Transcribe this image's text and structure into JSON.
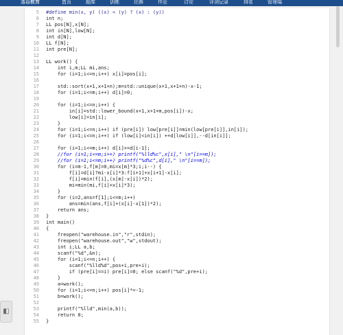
{
  "header": {
    "logo": "洛谷教育",
    "nav": [
      "首页",
      "题库",
      "训练",
      "比赛",
      "作业",
      "讨论",
      "评测记录",
      "排名",
      "管理端"
    ]
  },
  "side_button": "◧",
  "code_lines": [
    {
      "n": "5",
      "t": "#define min(x, y) ((x) < (y) ? (x) : (y))",
      "k": "pre"
    },
    {
      "n": "6",
      "t": "int n;"
    },
    {
      "n": "7",
      "t": "LL pos[N],x[N];"
    },
    {
      "n": "8",
      "t": "int in[N],low[N];"
    },
    {
      "n": "9",
      "t": "int d[N];"
    },
    {
      "n": "10",
      "t": "LL f[N];"
    },
    {
      "n": "11",
      "t": "int pre[N];"
    },
    {
      "n": "12",
      "t": ""
    },
    {
      "n": "13",
      "t": "LL work() {"
    },
    {
      "n": "14",
      "t": "    int i,m;LL mi,ans;"
    },
    {
      "n": "15",
      "t": "    for (i=1;i<=n;i++) x[i]=pos[i];"
    },
    {
      "n": "16",
      "t": ""
    },
    {
      "n": "17",
      "t": "    std::sort(x+1,x+1+n);m=std::unique(x+1,x+1+n)-x-1;"
    },
    {
      "n": "18",
      "t": "    for (i=1;i<=m;i++) d[i]=0;"
    },
    {
      "n": "19",
      "t": ""
    },
    {
      "n": "20",
      "t": "    for (i=1;i<=n;i++) {"
    },
    {
      "n": "21",
      "t": "        in[i]=std::lower_bound(x+1,x+1+m,pos[i])-x;"
    },
    {
      "n": "22",
      "t": "        low[i]=in[i];"
    },
    {
      "n": "23",
      "t": "    }"
    },
    {
      "n": "24",
      "t": "    for (i=1;i<=n;i++) if (pre[i]) low[pre[i]]=min(low[pre[i]],in[i]);"
    },
    {
      "n": "25",
      "t": "    for (i=1;i<=n;i++) if (low[i]<in[i]) ++d[low[i]],--d[in[i]];"
    },
    {
      "n": "26",
      "t": ""
    },
    {
      "n": "27",
      "t": "    for (i=1;i<=m;i++) d[i]+=d[i-1];"
    },
    {
      "n": "28",
      "t": "    //for (i=1;i<=m;i++) printf(\"%lld%c\",x[i],\" \\n\"[i==m]);",
      "k": "cm"
    },
    {
      "n": "29",
      "t": "    //for (i=1;i<=m;i++) printf(\"%d%c\",d[i],\" \\n\"[i==m]);",
      "k": "cm"
    },
    {
      "n": "30",
      "t": "    for (i=m-1,f[m]=0,mi=x[m]*3;i;i--) {"
    },
    {
      "n": "31",
      "t": "        f[i]=d[i]?mi-x[i]*3:f[i+1]+x[i+1]-x[i];"
    },
    {
      "n": "32",
      "t": "        f[i]=min(f[i],(x[m]-x[i])*2);"
    },
    {
      "n": "33",
      "t": "        mi=min(mi,f[i]+x[i]*3);"
    },
    {
      "n": "34",
      "t": "    }"
    },
    {
      "n": "35",
      "t": "    for (i=2,ans=f[1];i<=m;i++)"
    },
    {
      "n": "36",
      "t": "        ans=min(ans,f[i]+(x[i]-x[1])*2);"
    },
    {
      "n": "37",
      "t": "    return ans;"
    },
    {
      "n": "38",
      "t": "}"
    },
    {
      "n": "39",
      "t": "int main()"
    },
    {
      "n": "40",
      "t": "{"
    },
    {
      "n": "41",
      "t": "    freopen(\"warehouse.in\",\"r\",stdin);"
    },
    {
      "n": "42",
      "t": "    freopen(\"warehouse.out\",\"w\",stdout);"
    },
    {
      "n": "43",
      "t": "    int i;LL a,b;"
    },
    {
      "n": "44",
      "t": "    scanf(\"%d\",&n);"
    },
    {
      "n": "45",
      "t": "    for (i=1;i<=n;i++) {"
    },
    {
      "n": "46",
      "t": "        scanf(\"%lld%d\",pos+i,pre+i);"
    },
    {
      "n": "47",
      "t": "        if (pre[i]==i) pre[i]=0; else scanf(\"%d\",pre+i);"
    },
    {
      "n": "48",
      "t": "    }"
    },
    {
      "n": "49",
      "t": "    a=work();"
    },
    {
      "n": "50",
      "t": "    for (i=1;i<=n;i++) pos[i]*=-1;"
    },
    {
      "n": "51",
      "t": "    b=work();"
    },
    {
      "n": "52",
      "t": ""
    },
    {
      "n": "53",
      "t": "    printf(\"%lld\",min(a,b));"
    },
    {
      "n": "54",
      "t": "    return 0;"
    },
    {
      "n": "55",
      "t": "}"
    }
  ]
}
